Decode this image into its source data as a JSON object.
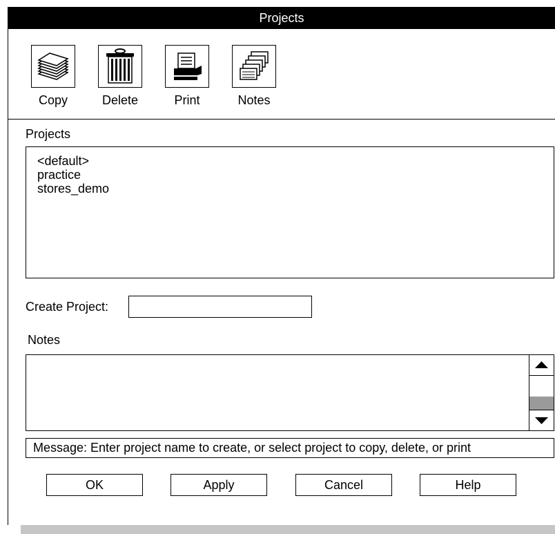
{
  "window": {
    "title": "Projects"
  },
  "toolbar": {
    "items": [
      {
        "label": "Copy",
        "icon": "copy-icon"
      },
      {
        "label": "Delete",
        "icon": "trash-can-icon"
      },
      {
        "label": "Print",
        "icon": "printer-icon"
      },
      {
        "label": "Notes",
        "icon": "notes-cards-icon"
      }
    ]
  },
  "projects": {
    "label": "Projects",
    "items": [
      "<default>",
      "practice",
      "stores_demo"
    ]
  },
  "create_project": {
    "label": "Create Project:",
    "value": ""
  },
  "notes": {
    "label": "Notes",
    "value": ""
  },
  "message": {
    "text": "Message: Enter project name to create, or select project to copy, delete, or print"
  },
  "buttons": {
    "ok": "OK",
    "apply": "Apply",
    "cancel": "Cancel",
    "help": "Help"
  }
}
